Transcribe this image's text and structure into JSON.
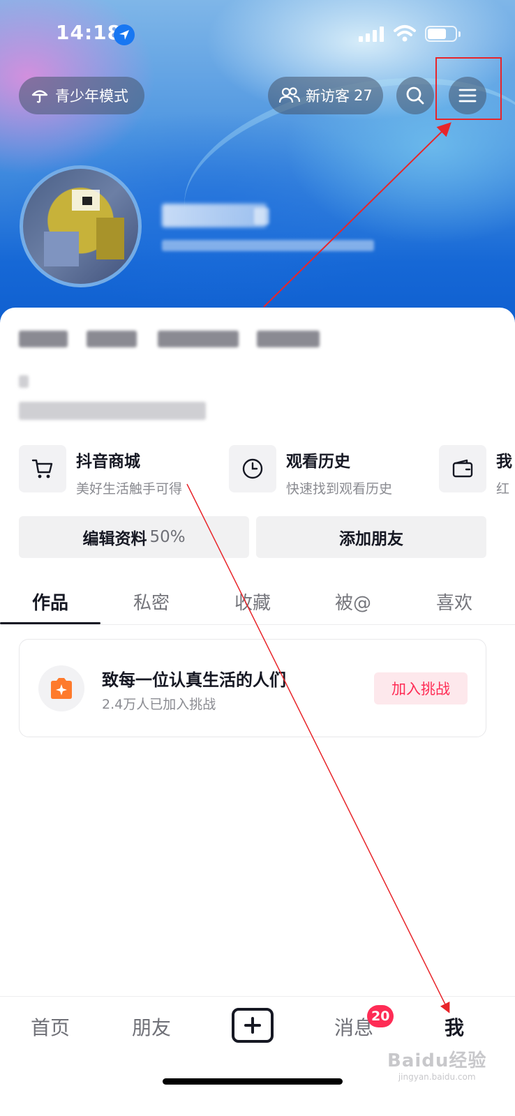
{
  "status_bar": {
    "time": "14:18",
    "location_icon": "location-arrow-icon",
    "signal_icon": "cellular-signal-icon",
    "wifi_icon": "wifi-icon",
    "battery_icon": "battery-icon"
  },
  "header": {
    "teen_mode_label": "青少年模式",
    "visitors_label": "新访客",
    "visitors_count": "27",
    "search_icon": "search-icon",
    "menu_icon": "hamburger-menu-icon",
    "annotation_color": "#e8252a"
  },
  "features": [
    {
      "icon": "cart-icon",
      "title": "抖音商城",
      "subtitle": "美好生活触手可得"
    },
    {
      "icon": "clock-icon",
      "title": "观看历史",
      "subtitle": "快速找到观看历史"
    },
    {
      "icon": "wallet-icon",
      "title": "我",
      "subtitle": "红"
    }
  ],
  "actions": {
    "edit_label": "编辑资料",
    "edit_percent": "50%",
    "add_friend_label": "添加朋友"
  },
  "tabs": [
    "作品",
    "私密",
    "收藏",
    "被@",
    "喜欢"
  ],
  "challenge": {
    "icon": "camera-sparkle-icon",
    "title": "致每一位认真生活的人们",
    "subtitle": "2.4万人已加入挑战",
    "button_label": "加入挑战",
    "accent": "#fe2c55"
  },
  "bottom_nav": {
    "home": "首页",
    "friends": "朋友",
    "create_icon": "plus-icon",
    "messages": "消息",
    "messages_badge": "20",
    "me": "我"
  },
  "watermark": {
    "brand": "Baidu经验",
    "url": "jingyan.baidu.com"
  }
}
